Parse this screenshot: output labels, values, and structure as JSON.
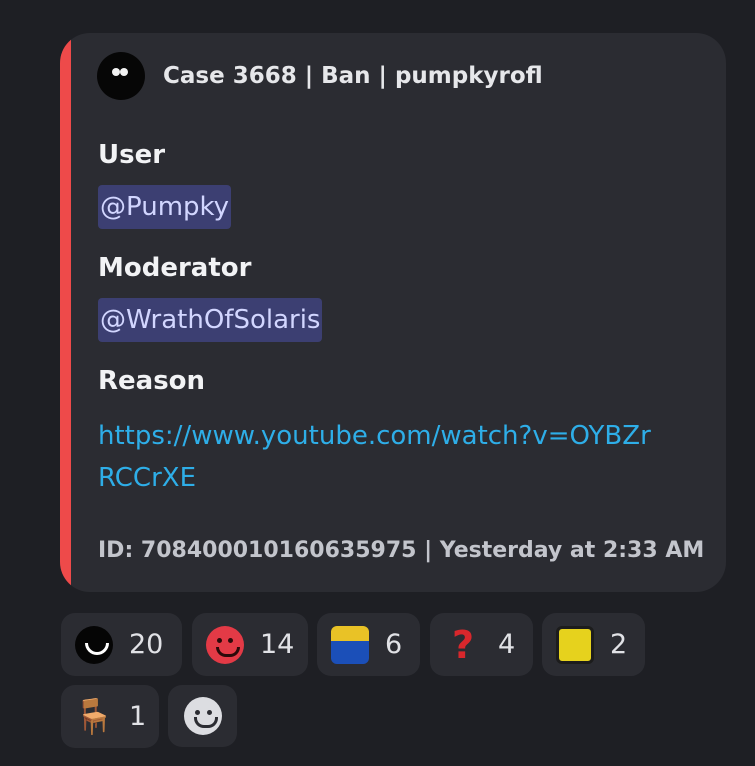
{
  "embed": {
    "accent_color": "#ee4a4a",
    "author": {
      "avatar_icon": "black-blob-avatar",
      "name": "Case 3668 | Ban | pumpkyrofl"
    },
    "fields": [
      {
        "name": "User",
        "value": "@Pumpky",
        "type": "mention"
      },
      {
        "name": "Moderator",
        "value": "@WrathOfSolaris",
        "type": "mention"
      },
      {
        "name": "Reason",
        "value": "https://www.youtube.com/watch?v=OYBZrRCCrXE",
        "type": "link"
      }
    ],
    "footer": "ID: 708400010160635975 | Yesterday at 2:33 AM"
  },
  "reactions": [
    {
      "emoji": "black-smile-emoji",
      "count": "20"
    },
    {
      "emoji": "red-smile-emoji",
      "count": "14"
    },
    {
      "emoji": "figure-emoji",
      "count": "6"
    },
    {
      "emoji": "question-mark-emoji",
      "count": "4"
    },
    {
      "emoji": "yellow-face-emoji",
      "count": "2"
    },
    {
      "emoji": "chair-emoji",
      "count": "1"
    }
  ],
  "add_reaction_icon": "add-reaction-icon",
  "colors": {
    "background": "#1e1f24",
    "embed_bg": "#2b2c32",
    "mention_bg": "#3c3f72",
    "link": "#2eaee8"
  }
}
